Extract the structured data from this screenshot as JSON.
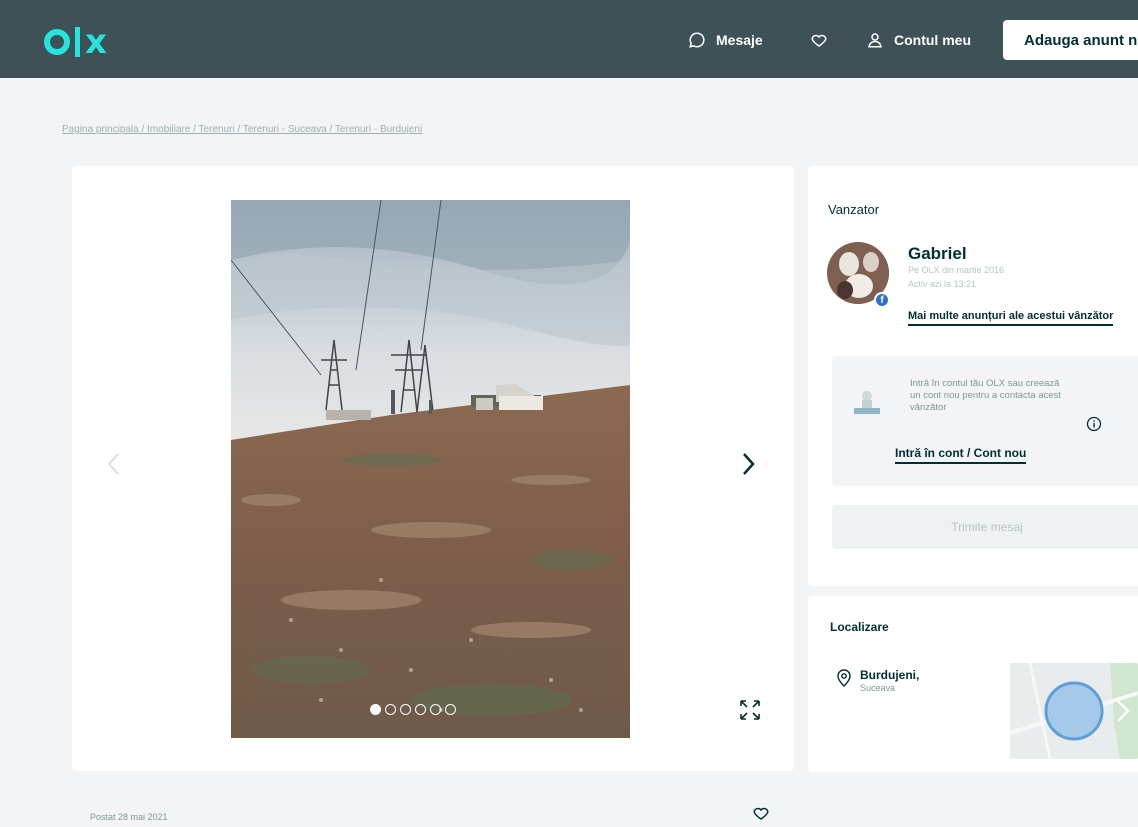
{
  "header": {
    "logo": "olx",
    "messages_label": "Mesaje",
    "account_label": "Contul meu",
    "add_ad_label": "Adauga anunt nou"
  },
  "breadcrumb": "Pagina principala / Imobiliare / Terenuri / Terenuri - Suceava / Terenuri - Burdujeni",
  "gallery": {
    "dots_total": 6,
    "active_dot": 1,
    "posted_label": "Postat 28 mai 2021"
  },
  "seller": {
    "section_title": "Vanzator",
    "name": "Gabriel",
    "member_since": "Pe OLX din martie 2016",
    "last_active": "Activ azi la 13:21",
    "more_ads_label": "Mai multe anunțuri ale acestui vânzător",
    "login_prompt": "Intră în contul tău OLX sau creează un cont nou pentru a contacta acest vânzător",
    "login_link": "Intră în cont / Cont nou",
    "send_message_label": "Trimite mesaj"
  },
  "location": {
    "section_title": "Localizare",
    "city": "Burdujeni,",
    "region": "Suceava"
  },
  "colors": {
    "header_bg": "#3d5156",
    "brand_teal": "#23e5db",
    "text_dark": "#002f34"
  }
}
